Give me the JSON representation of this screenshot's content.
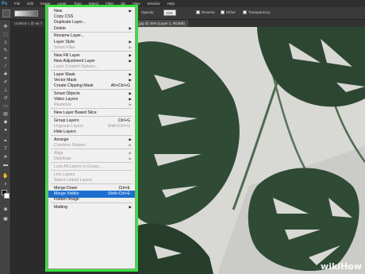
{
  "app": {
    "logo": "Ps"
  },
  "menubar": [
    "File",
    "Edit",
    "Image",
    "Layer",
    "Type",
    "Select",
    "Filter",
    "3D",
    "View",
    "Window",
    "Help"
  ],
  "options": {
    "opacity_label": "Opacity:",
    "opacity_value": "43%",
    "reverse": "Reverse",
    "dither": "Dither",
    "transparency": "Transparency"
  },
  "tabs": {
    "left": "Untitled-1 @ 66.7",
    "right": "ant.jpg @ 25% (Layer 2, RGB/8)"
  },
  "context_menu": [
    {
      "label": "New",
      "arrow": true
    },
    {
      "label": "Copy CSS"
    },
    {
      "label": "Duplicate Layer..."
    },
    {
      "label": "Delete",
      "arrow": true
    },
    {
      "sep": true
    },
    {
      "label": "Rename Layer..."
    },
    {
      "label": "Layer Style",
      "arrow": true
    },
    {
      "label": "Smart Filter",
      "disabled": true,
      "arrow": true
    },
    {
      "sep": true
    },
    {
      "label": "New Fill Layer",
      "arrow": true
    },
    {
      "label": "New Adjustment Layer",
      "arrow": true
    },
    {
      "label": "Layer Content Options...",
      "disabled": true
    },
    {
      "sep": true
    },
    {
      "label": "Layer Mask",
      "arrow": true
    },
    {
      "label": "Vector Mask",
      "arrow": true
    },
    {
      "label": "Create Clipping Mask",
      "shortcut": "Alt+Ctrl+G"
    },
    {
      "sep": true
    },
    {
      "label": "Smart Objects",
      "arrow": true
    },
    {
      "label": "Video Layers",
      "arrow": true
    },
    {
      "label": "Rasterize",
      "disabled": true,
      "arrow": true
    },
    {
      "sep": true
    },
    {
      "label": "New Layer Based Slice"
    },
    {
      "sep": true
    },
    {
      "label": "Group Layers",
      "shortcut": "Ctrl+G"
    },
    {
      "label": "Ungroup Layers",
      "shortcut": "Shift+Ctrl+G",
      "disabled": true
    },
    {
      "label": "Hide Layers"
    },
    {
      "sep": true
    },
    {
      "label": "Arrange",
      "arrow": true
    },
    {
      "label": "Combine Shapes",
      "disabled": true,
      "arrow": true
    },
    {
      "sep": true
    },
    {
      "label": "Align",
      "disabled": true,
      "arrow": true
    },
    {
      "label": "Distribute",
      "disabled": true,
      "arrow": true
    },
    {
      "sep": true
    },
    {
      "label": "Lock All Layers in Group...",
      "disabled": true
    },
    {
      "sep": true
    },
    {
      "label": "Link Layers",
      "disabled": true
    },
    {
      "label": "Select Linked Layers",
      "disabled": true
    },
    {
      "sep": true
    },
    {
      "label": "Merge Down",
      "shortcut": "Ctrl+E"
    },
    {
      "label": "Merge Visible",
      "shortcut": "Shift+Ctrl+E",
      "highlight": true
    },
    {
      "label": "Flatten Image"
    },
    {
      "sep": true
    },
    {
      "label": "Matting",
      "arrow": true
    }
  ],
  "colors": {
    "highlight": "#1c6fd0",
    "frame": "#37e13d",
    "leaf": "#2f4a35"
  },
  "watermark": {
    "wiki": "wiki",
    "how": "How"
  }
}
